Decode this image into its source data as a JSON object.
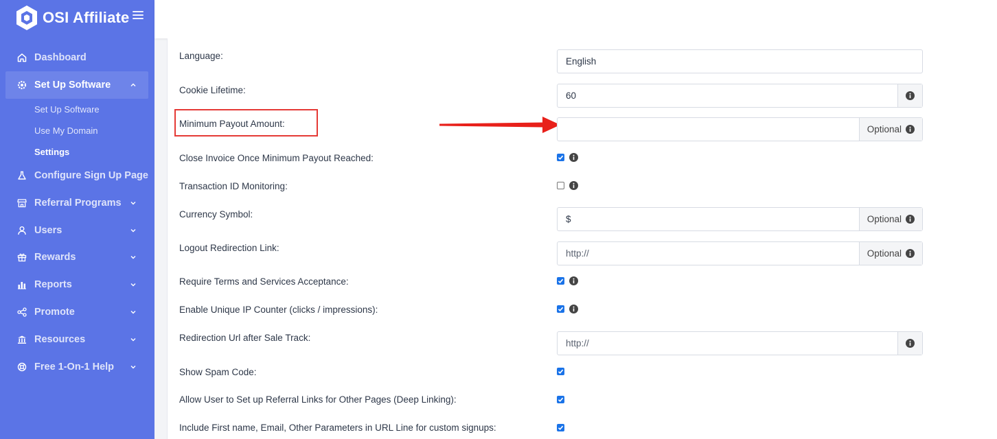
{
  "brand": {
    "name": "OSI Affiliate"
  },
  "sidebar": {
    "items": [
      {
        "label": "Dashboard",
        "icon": "home-icon"
      },
      {
        "label": "Set Up Software",
        "icon": "gear-icon",
        "active": true,
        "expanded": true
      },
      {
        "label": "Configure Sign Up Page",
        "icon": "flask-icon"
      },
      {
        "label": "Referral Programs",
        "icon": "store-icon"
      },
      {
        "label": "Users",
        "icon": "user-icon"
      },
      {
        "label": "Rewards",
        "icon": "gift-icon"
      },
      {
        "label": "Reports",
        "icon": "bar-chart-icon"
      },
      {
        "label": "Promote",
        "icon": "share-icon"
      },
      {
        "label": "Resources",
        "icon": "bank-icon"
      },
      {
        "label": "Free 1-On-1 Help",
        "icon": "lifebuoy-icon"
      }
    ],
    "subitems": [
      {
        "label": "Set Up Software"
      },
      {
        "label": "Use My Domain"
      },
      {
        "label": "Settings",
        "current": true
      }
    ]
  },
  "settings": {
    "language": {
      "label": "Language:",
      "value": "English"
    },
    "cookie_lifetime": {
      "label": "Cookie Lifetime:",
      "value": "60"
    },
    "min_payout": {
      "label": "Minimum Payout Amount:",
      "value": "",
      "addon": "Optional"
    },
    "close_invoice": {
      "label": "Close Invoice Once Minimum Payout Reached:",
      "checked": true
    },
    "transaction_id": {
      "label": "Transaction ID Monitoring:",
      "checked": false
    },
    "currency_symbol": {
      "label": "Currency Symbol:",
      "value": "$",
      "addon": "Optional"
    },
    "logout_redirect": {
      "label": "Logout Redirection Link:",
      "placeholder": "http://",
      "addon": "Optional"
    },
    "require_terms": {
      "label": "Require Terms and Services Acceptance:",
      "checked": true
    },
    "unique_ip": {
      "label": "Enable Unique IP Counter (clicks / impressions):",
      "checked": true
    },
    "redirect_after_sale": {
      "label": "Redirection Url after Sale Track:",
      "placeholder": "http://"
    },
    "show_spam": {
      "label": "Show Spam Code:",
      "checked": true
    },
    "deep_linking": {
      "label": "Allow User to Set up Referral Links for Other Pages (Deep Linking):",
      "checked": true
    },
    "include_params": {
      "label": "Include First name, Email, Other Parameters in URL Line for custom signups:",
      "checked": true
    }
  },
  "colors": {
    "sidebar": "#5b74e6",
    "highlight": "#e53935",
    "checkbox": "#1a73e8"
  }
}
